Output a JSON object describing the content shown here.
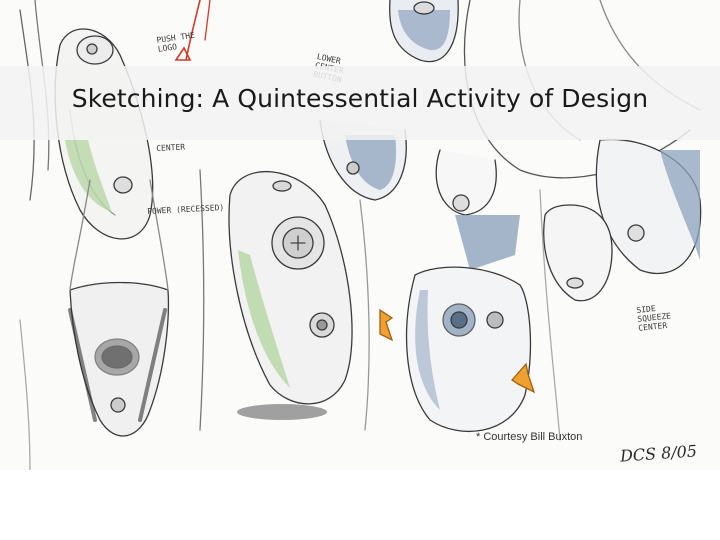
{
  "slide": {
    "title": "Sketching: A Quintessential Activity of Design",
    "credit": "* Courtesy Bill Buxton"
  },
  "sketch_notes": {
    "note_top": "PUSH THE LOGO",
    "note_center": "CENTER",
    "note_power": "POWER (RECESSED)",
    "note_lower_center": "LOWER CENTER BUTTON",
    "note_side": "SIDE SQUEEZE CENTER",
    "signature": "DCS 8/05"
  },
  "colors": {
    "accent_green": "#b9d7a8",
    "accent_blue": "#8ea3bd",
    "accent_orange": "#f0a030",
    "accent_red": "#d23a2a",
    "title_band": "#f2f2f2"
  }
}
